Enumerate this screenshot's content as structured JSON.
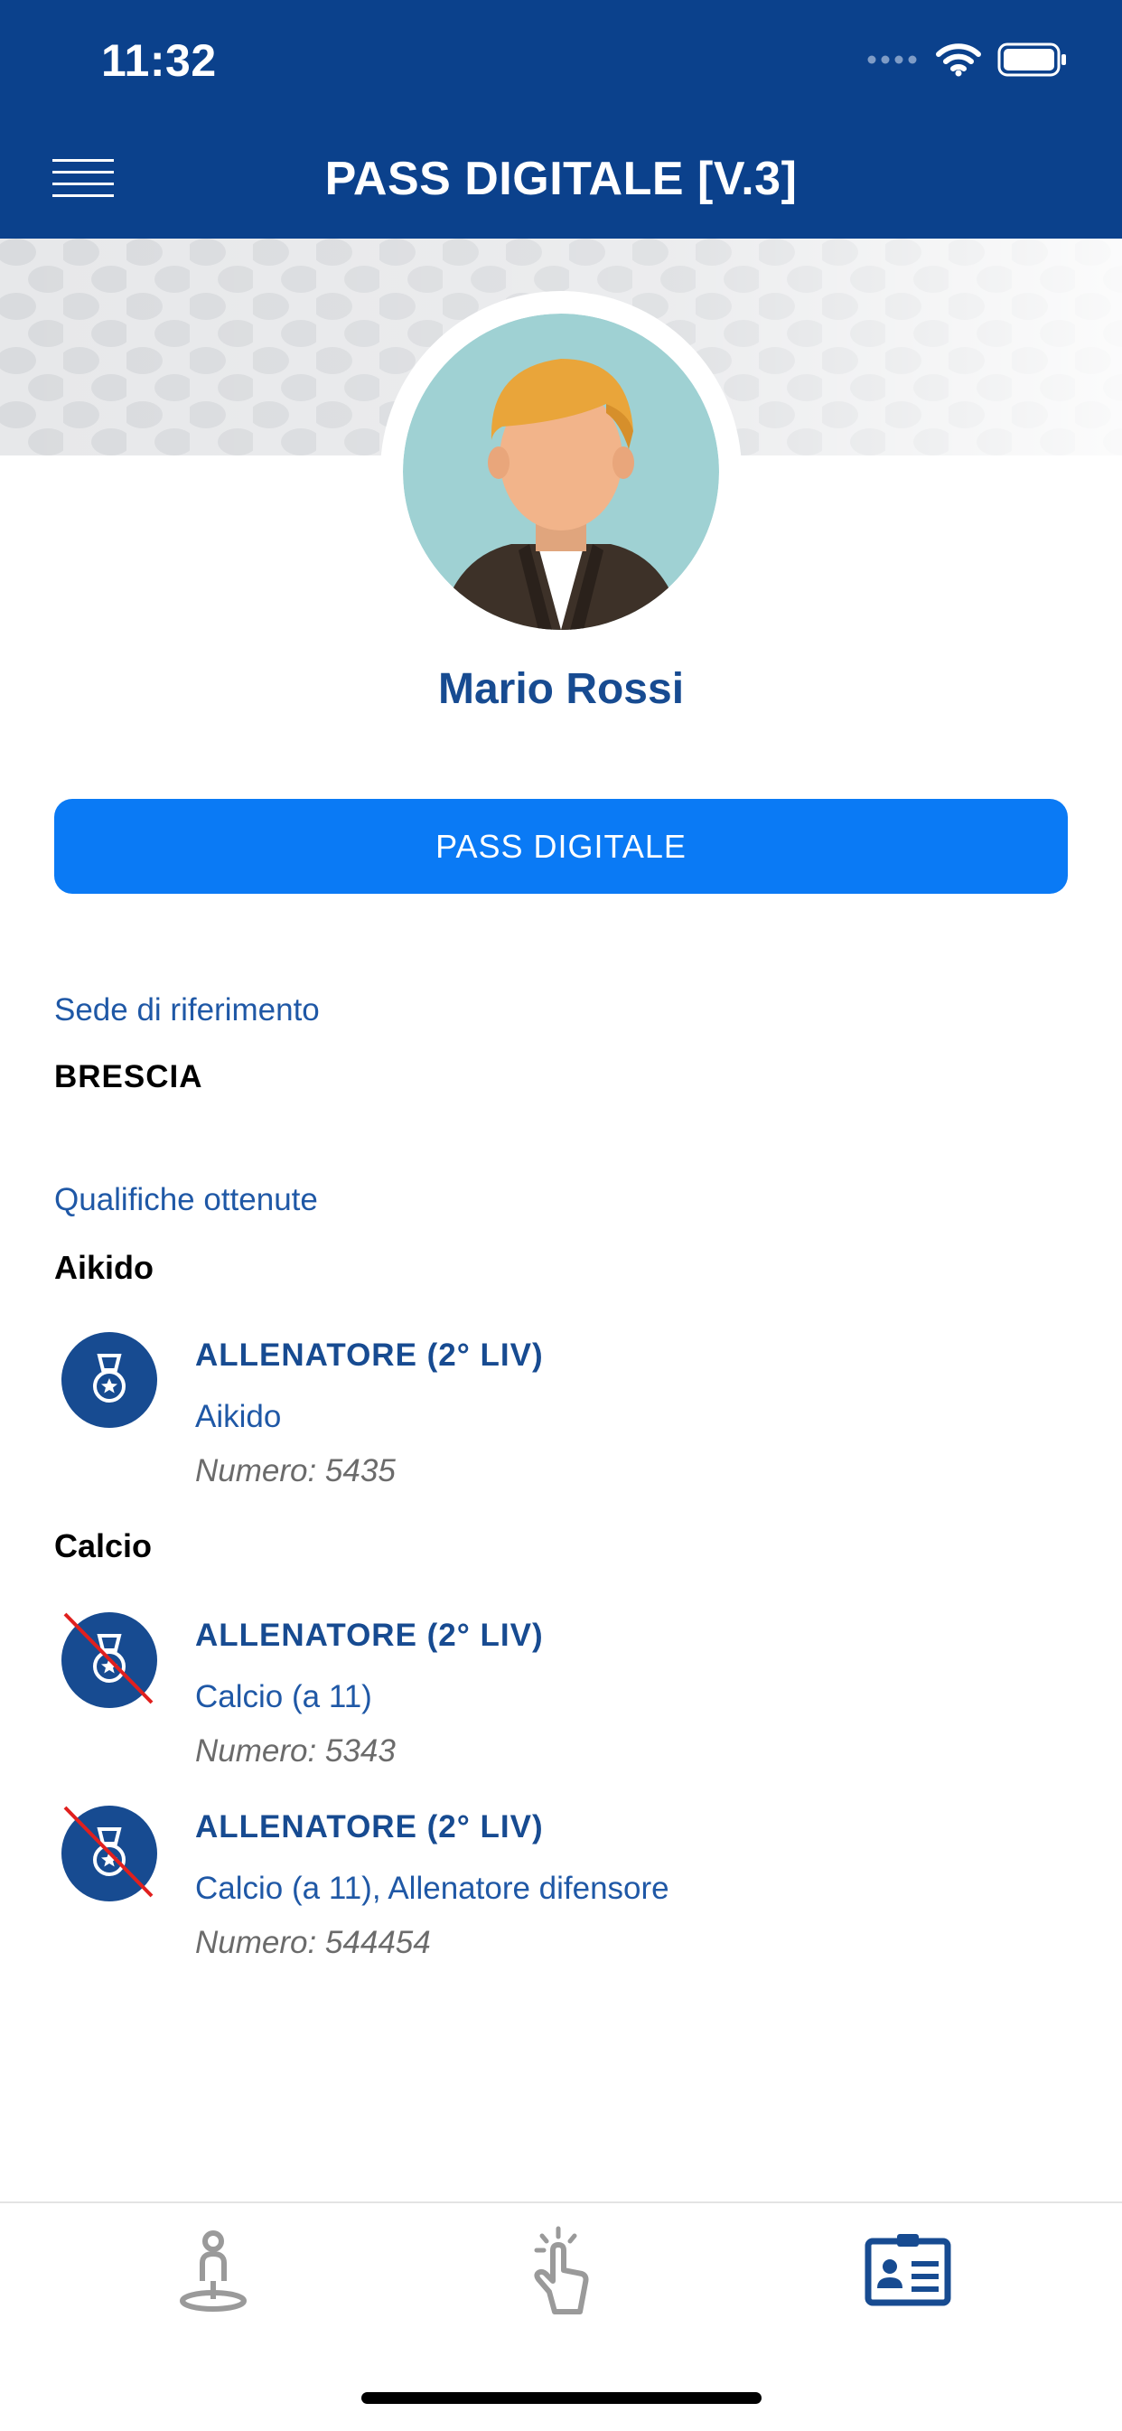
{
  "status_bar": {
    "time": "11:32"
  },
  "nav": {
    "title": "PASS DIGITALE [V.3]",
    "menu_icon": "hamburger-menu-icon"
  },
  "profile": {
    "name": "Mario Rossi"
  },
  "primary_button": {
    "label": "PASS DIGITALE"
  },
  "sede": {
    "label": "Sede di riferimento",
    "value": "BRESCIA"
  },
  "qualifiche": {
    "label": "Qualifiche ottenute",
    "groups": [
      {
        "sport": "Aikido",
        "items": [
          {
            "title": "ALLENATORE (2° LIV)",
            "description": "Aikido",
            "number": "Numero: 5435",
            "revoked": false
          }
        ]
      },
      {
        "sport": "Calcio",
        "items": [
          {
            "title": "ALLENATORE (2° LIV)",
            "description": "Calcio (a 11)",
            "number": "Numero: 5343",
            "revoked": true
          },
          {
            "title": "ALLENATORE (2° LIV)",
            "description": "Calcio (a 11), Allenatore difensore",
            "number": "Numero: 544454",
            "revoked": true
          }
        ]
      }
    ]
  },
  "tabbar": {
    "tabs": [
      {
        "icon": "location-person-icon",
        "active": false
      },
      {
        "icon": "tap-hand-icon",
        "active": false
      },
      {
        "icon": "id-card-icon",
        "active": true
      }
    ]
  },
  "colors": {
    "nav_background": "#0b418c",
    "primary_button": "#0a7af5",
    "accent_text": "#174b91",
    "revoked_stroke": "#e0201e",
    "tab_inactive": "#9a9a9a"
  }
}
